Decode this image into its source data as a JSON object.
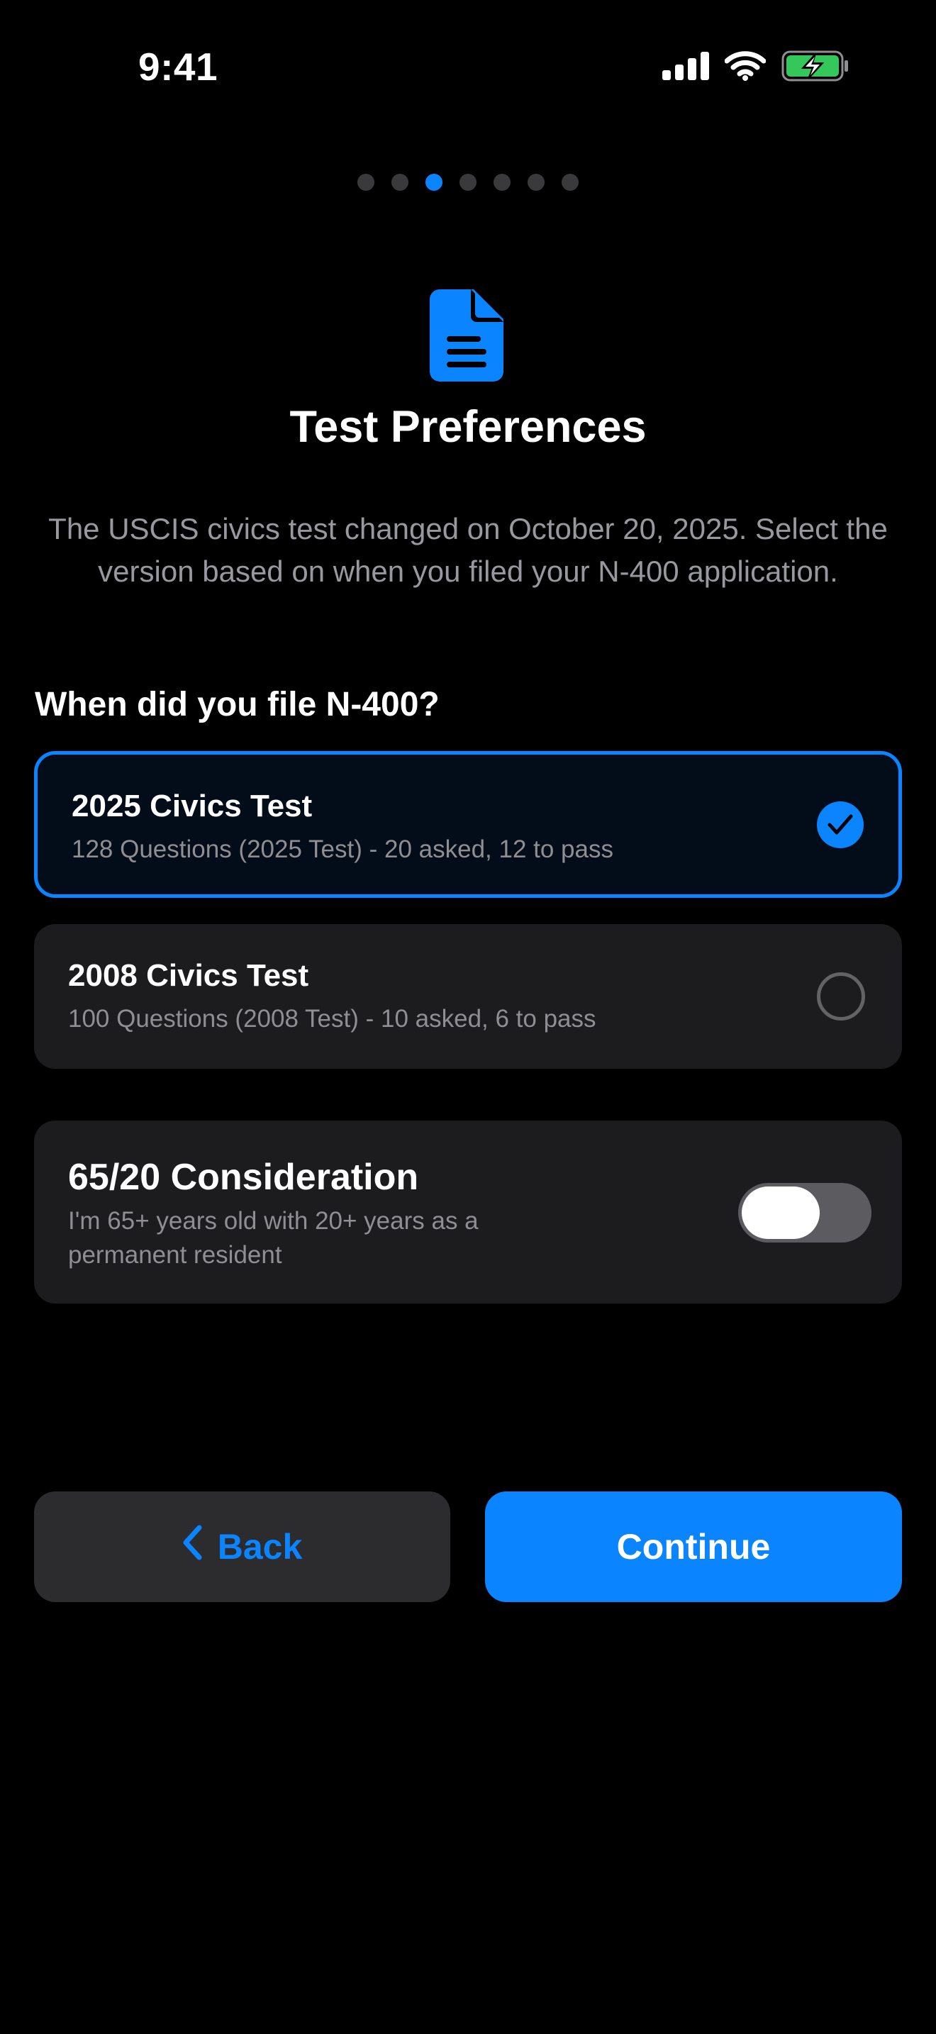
{
  "status_bar": {
    "time": "9:41",
    "icons": [
      "signal-icon",
      "wifi-icon",
      "battery-charging-icon"
    ]
  },
  "pager": {
    "total": 7,
    "current": 3
  },
  "header": {
    "icon": "document-icon",
    "title": "Test Preferences",
    "intro": "The USCIS civics test changed on October 20, 2025. Select the version based on when you filed your N-400 application."
  },
  "question": "When did you file N-400?",
  "options": [
    {
      "title": "2025 Civics Test",
      "subtitle": "128 Questions (2025 Test) - 20 asked, 12 to pass",
      "selected": true
    },
    {
      "title": "2008 Civics Test",
      "subtitle": "100 Questions (2008 Test) - 10 asked, 6 to pass",
      "selected": false
    }
  ],
  "consideration": {
    "title": "65/20 Consideration",
    "subtitle": "I'm 65+ years old with 20+ years as a permanent resident",
    "enabled": false
  },
  "buttons": {
    "back_label": "Back",
    "continue_label": "Continue"
  },
  "colors": {
    "background": "#000000",
    "accent": "#0a84ff",
    "card": "#1c1c1e",
    "battery": "#34c759"
  }
}
